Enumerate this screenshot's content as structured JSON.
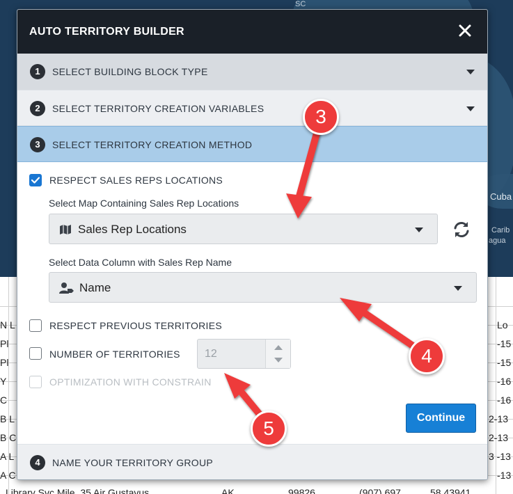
{
  "background": {
    "map_labels": [
      "SC",
      "Cuba",
      "Carib",
      "agua"
    ],
    "grid_col1": [
      "N L",
      "Pl",
      "Pl",
      "Y",
      "C",
      "B L",
      "B C",
      "A L",
      "A C",
      "Library Svc Mile. 35 Air Gustavus"
    ],
    "grid_col2": [
      "Lo",
      "-15",
      "-15",
      "-16",
      "-16",
      "2-13",
      "2-13",
      "3 -13",
      "-13"
    ],
    "grid_bottom_row": [
      "AK",
      "99826",
      "(907) 697",
      "58.43941"
    ]
  },
  "modal": {
    "title": "AUTO TERRITORY BUILDER",
    "close_icon": "close-icon",
    "steps": [
      {
        "number": "1",
        "label": "SELECT BUILDING BLOCK TYPE"
      },
      {
        "number": "2",
        "label": "SELECT TERRITORY CREATION VARIABLES"
      },
      {
        "number": "3",
        "label": "SELECT TERRITORY CREATION METHOD"
      },
      {
        "number": "4",
        "label": "NAME YOUR TERRITORY GROUP"
      }
    ],
    "respect_sales_reps": {
      "label": "RESPECT SALES REPS LOCATIONS",
      "checked": true
    },
    "map_select": {
      "label": "Select Map Containing Sales Rep Locations",
      "value": "Sales Rep Locations",
      "icon": "map-icon"
    },
    "refresh_icon": "refresh-icon",
    "column_select": {
      "label": "Select Data Column with Sales Rep Name",
      "value": "Name",
      "icon": "user-tag-icon"
    },
    "respect_previous": {
      "label": "RESPECT PREVIOUS TERRITORIES",
      "checked": false
    },
    "number_of_territories": {
      "label": "NUMBER OF TERRITORIES",
      "checked": false,
      "value": "12"
    },
    "optimization": {
      "label": "OPTIMIZATION WITH CONSTRAIN",
      "checked": false,
      "disabled": true
    },
    "continue_label": "Continue"
  },
  "annotations": {
    "badges": [
      "3",
      "4",
      "5"
    ],
    "arrow_color": "#ee3b3b"
  }
}
